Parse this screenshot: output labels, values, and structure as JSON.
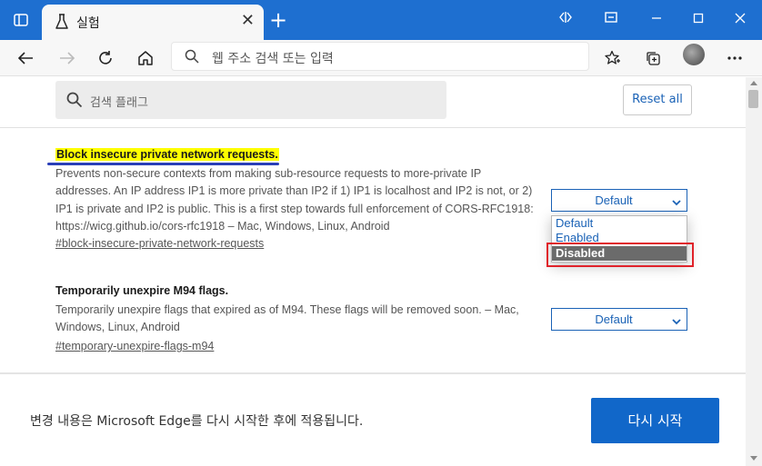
{
  "tab": {
    "title": "실험",
    "close_label": "✕"
  },
  "new_tab_label": "+",
  "address": {
    "placeholder": "웹 주소 검색 또는 입력"
  },
  "search": {
    "placeholder": "검색 플래그"
  },
  "reset_all_label": "Reset all",
  "flags": [
    {
      "title": "Block insecure private network requests.",
      "description": "Prevents non-secure contexts from making sub-resource requests to more-private IP addresses. An IP address IP1 is more private than IP2 if 1) IP1 is localhost and IP2 is not, or 2) IP1 is private and IP2 is public. This is a first step towards full enforcement of CORS-RFC1918: https://wicg.github.io/cors-rfc1918 – Mac, Windows, Linux, Android",
      "link": "#block-insecure-private-network-requests",
      "selected": "Default",
      "options": [
        "Default",
        "Enabled",
        "Disabled"
      ],
      "highlighted_option": "Disabled"
    },
    {
      "title": "Temporarily unexpire M94 flags.",
      "description": "Temporarily unexpire flags that expired as of M94. These flags will be removed soon. – Mac, Windows, Linux, Android",
      "link": "#temporary-unexpire-flags-m94",
      "selected": "Default"
    }
  ],
  "footer": {
    "message": "변경 내용은 Microsoft Edge를 다시 시작한 후에 적용됩니다.",
    "restart_label": "다시 시작"
  },
  "colors": {
    "titlebar": "#1e6fd0",
    "accent": "#1a62b6",
    "highlight": "#ffff00",
    "annotation": "#e0222a"
  }
}
